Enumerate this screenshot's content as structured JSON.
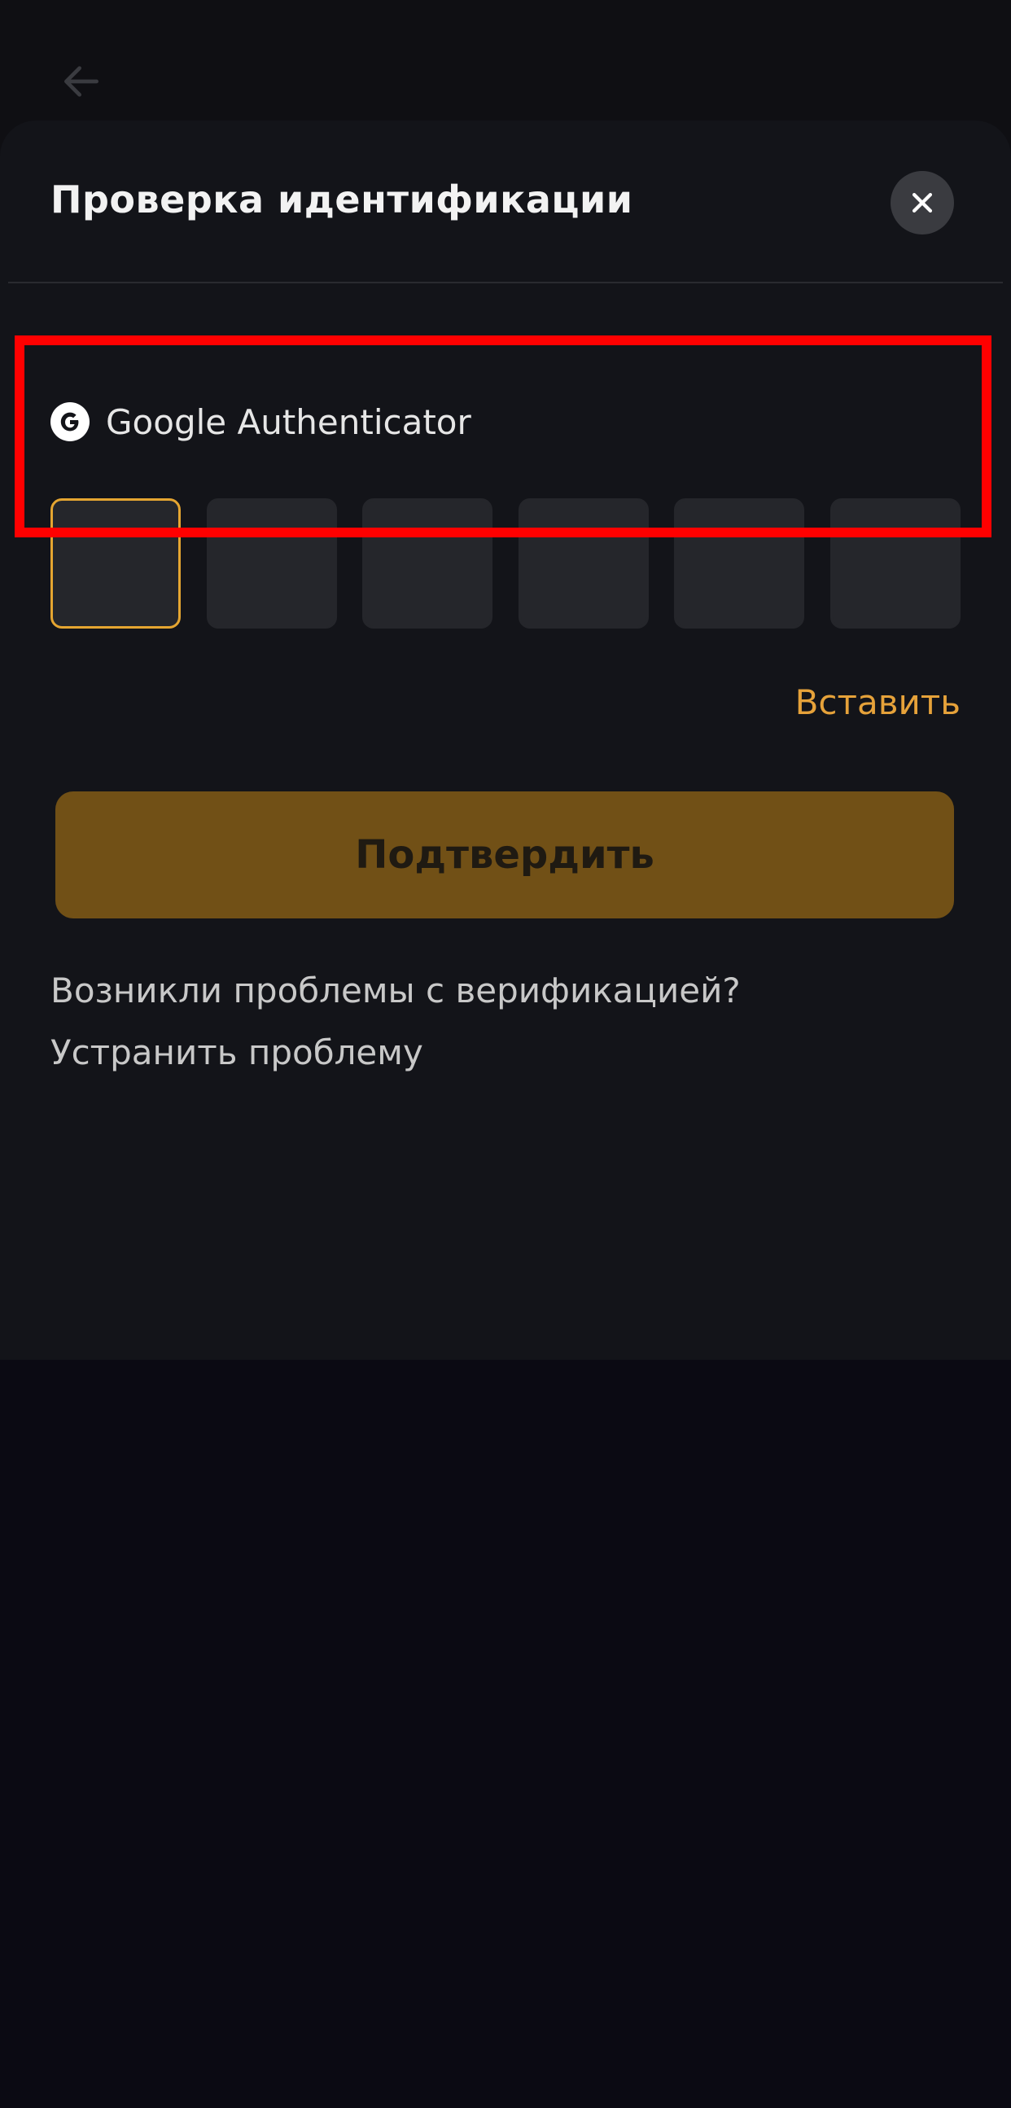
{
  "header": {
    "back_icon": "arrow-left-icon"
  },
  "sheet": {
    "title": "Проверка идентификации",
    "close_icon": "close-icon"
  },
  "authenticator": {
    "icon": "google-icon",
    "label": "Google Authenticator",
    "code_length": 6,
    "active_index": 0,
    "digits": [
      "",
      "",
      "",
      "",
      "",
      ""
    ]
  },
  "actions": {
    "paste_label": "Вставить",
    "confirm_label": "Подтвердить"
  },
  "help": {
    "question": "Возникли проблемы с верификацией?",
    "link": "Устранить проблему"
  },
  "colors": {
    "accent": "#e6a23a",
    "confirm_bg": "#715016",
    "sheet_bg": "#131419",
    "code_box_bg": "#25262b",
    "highlight": "#ff0000"
  }
}
